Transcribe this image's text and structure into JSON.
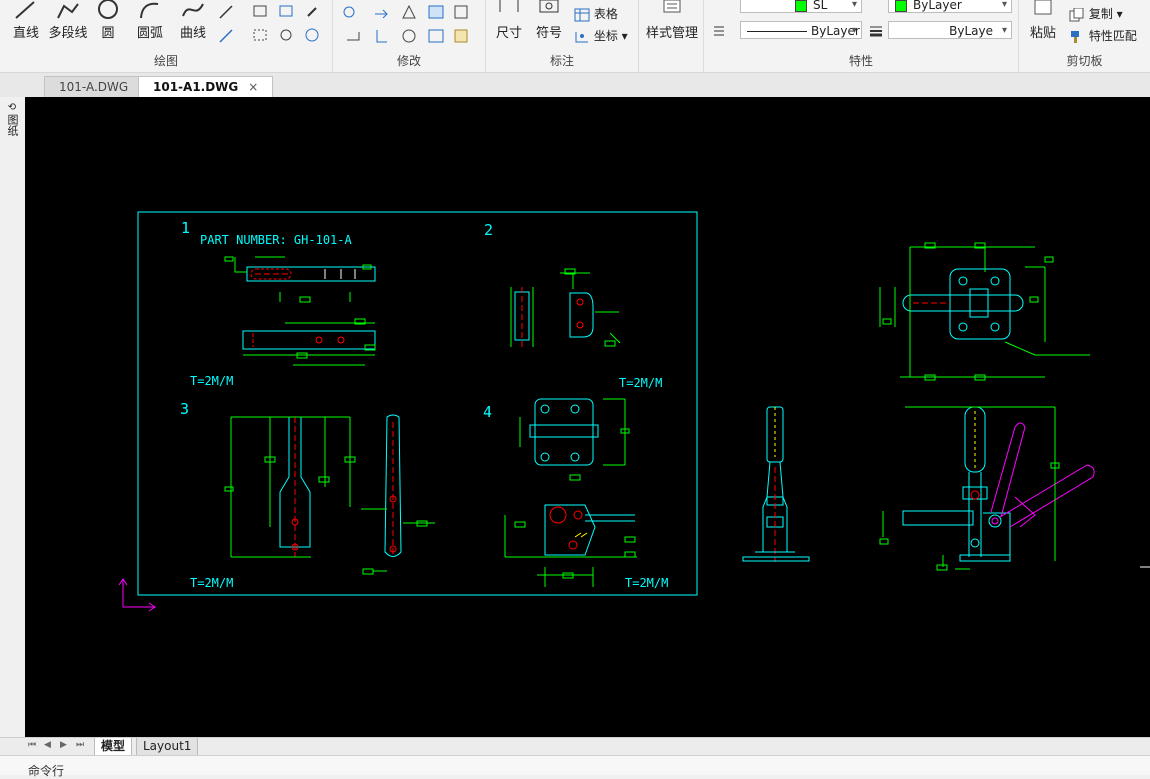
{
  "ribbon": {
    "draw": {
      "label": "绘图",
      "line": "直线",
      "polyline": "多段线",
      "circle": "圆",
      "arc": "圆弧",
      "curve": "曲线"
    },
    "modify": {
      "label": "修改"
    },
    "annotate": {
      "label": "标注",
      "dimension": "尺寸",
      "symbol": "符号",
      "table": "表格",
      "coordinate": "坐标"
    },
    "style": {
      "label": "样式管理"
    },
    "properties": {
      "label": "特性",
      "layer_value": "SL",
      "color_value": "ByLayer",
      "linetype_value": "ByLayer",
      "lineweight_value": "ByLaye"
    },
    "clipboard": {
      "label": "剪切板",
      "paste": "粘贴",
      "copy": "复制",
      "match": "特性匹配"
    }
  },
  "doc_tabs": [
    {
      "label": "101-A.DWG",
      "active": false
    },
    {
      "label": "101-A1.DWG",
      "active": true
    }
  ],
  "left_panel": {
    "label": "图纸"
  },
  "drawing": {
    "view1_index": "1",
    "view2_index": "2",
    "view3_index": "3",
    "view4_index": "4",
    "part_number": "PART NUMBER: GH-101-A",
    "thickness": "T=2M/M"
  },
  "layout_tabs": [
    {
      "label": "模型",
      "active": true
    },
    {
      "label": "Layout1",
      "active": false
    }
  ],
  "command": {
    "label": "命令行"
  },
  "colors": {
    "canvas": "#000000",
    "cyan": "#00ffff",
    "green": "#00ff00",
    "red": "#ff0000",
    "yellow": "#ffff00",
    "magenta": "#ff00ff",
    "white": "#ffffff"
  }
}
